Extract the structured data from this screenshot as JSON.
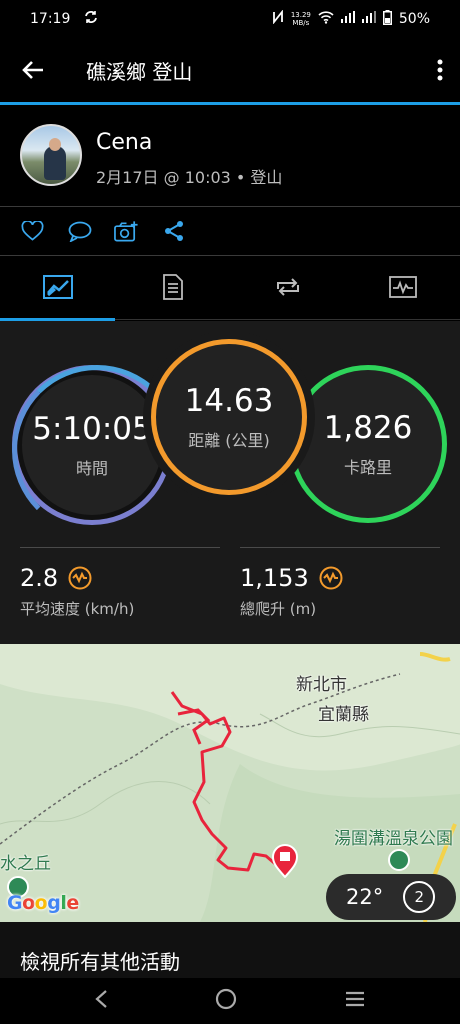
{
  "status_bar": {
    "time": "17:19",
    "net_speed_value": "13.29",
    "net_speed_unit": "MB/s",
    "battery": "50%"
  },
  "app_bar": {
    "title": "礁溪鄉 登山"
  },
  "user": {
    "name": "Cena",
    "meta": "2月17日 @ 10:03 • 登山"
  },
  "stats": {
    "time": {
      "value": "5:10:05",
      "label": "時間"
    },
    "distance": {
      "value": "14.63",
      "label": "距離 (公里)"
    },
    "calories": {
      "value": "1,826",
      "label": "卡路里"
    },
    "avg_speed": {
      "value": "2.8",
      "label": "平均速度 (km/h)"
    },
    "ascent": {
      "value": "1,153",
      "label": "總爬升 (m)"
    }
  },
  "map": {
    "labels": {
      "city1": "新北市",
      "county": "宜蘭縣",
      "hotspring": "湯圍溝溫泉公園",
      "hill": "水之丘"
    },
    "google": "Google",
    "temperature": "22°",
    "compass_number": "2"
  },
  "footer": {
    "view_all": "檢視所有其他活動"
  },
  "colors": {
    "accent": "#1d9ee6",
    "distance": "#f39a2c",
    "calories": "#2ed45a",
    "time": "#7b7fd0",
    "route": "#e8243c"
  }
}
